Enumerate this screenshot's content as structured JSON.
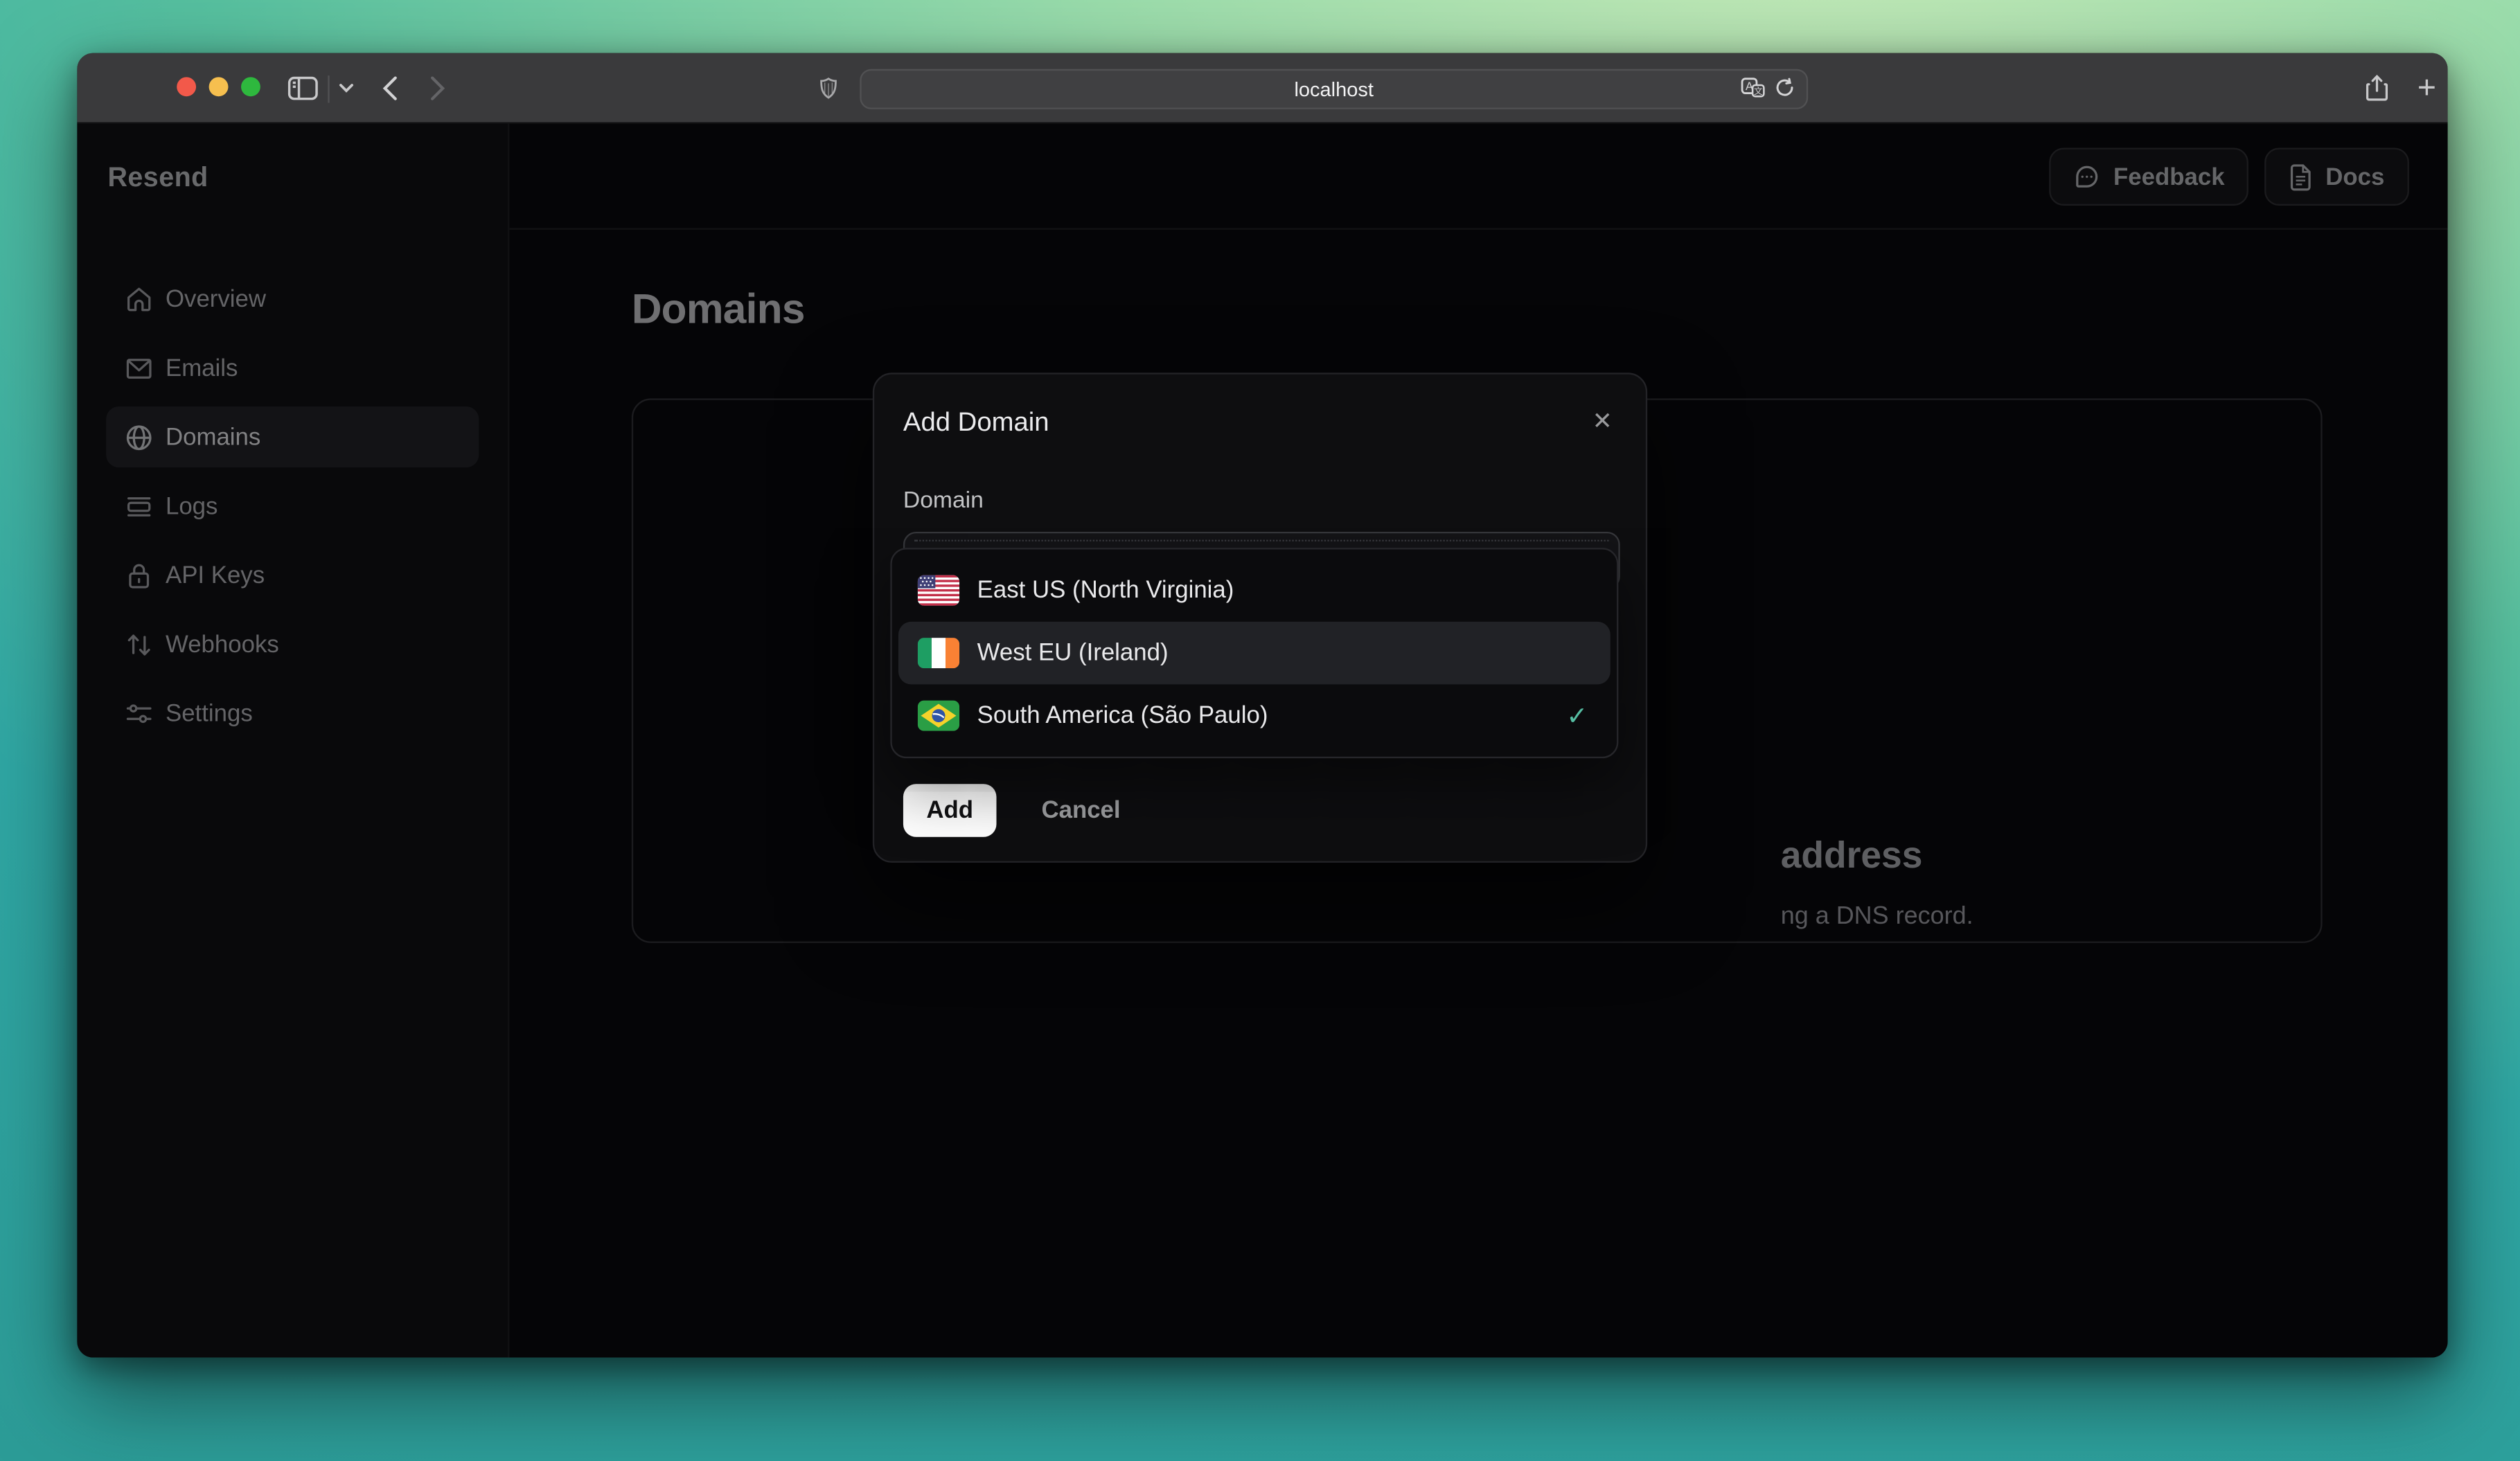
{
  "browser": {
    "url": "localhost",
    "traffic_lights": {
      "close": "#f2594a",
      "minimize": "#f6bf4f",
      "maximize": "#2eb83e"
    }
  },
  "glyphs": {
    "close": "✕",
    "check": "✓",
    "new_tab": "+"
  },
  "app": {
    "logo": "Resend",
    "sidebar": {
      "items": [
        {
          "label": "Overview",
          "icon": "home-icon"
        },
        {
          "label": "Emails",
          "icon": "mail-icon"
        },
        {
          "label": "Domains",
          "icon": "globe-icon",
          "active": true
        },
        {
          "label": "Logs",
          "icon": "logs-icon"
        },
        {
          "label": "API Keys",
          "icon": "lock-icon"
        },
        {
          "label": "Webhooks",
          "icon": "arrows-up-down-icon"
        },
        {
          "label": "Settings",
          "icon": "sliders-icon"
        }
      ]
    },
    "header": {
      "feedback_label": "Feedback",
      "docs_label": "Docs"
    },
    "page": {
      "title": "Domains",
      "empty_state_heading_fragment": "address",
      "empty_state_subtext_fragment": "ng a DNS record."
    },
    "modal": {
      "title": "Add Domain",
      "domain_label": "Domain",
      "region_dropdown": {
        "options": [
          {
            "label": "East US (North Virginia)",
            "flag": "us-flag-icon",
            "highlighted": false,
            "selected": false
          },
          {
            "label": "West EU (Ireland)",
            "flag": "ireland-flag-icon",
            "highlighted": true,
            "selected": false
          },
          {
            "label": "South America (São Paulo)",
            "flag": "brazil-flag-icon",
            "highlighted": false,
            "selected": true
          }
        ]
      },
      "add_label": "Add",
      "cancel_label": "Cancel"
    },
    "colors": {
      "check_accent": "#56bda2",
      "selection_bg": "#212226"
    }
  }
}
